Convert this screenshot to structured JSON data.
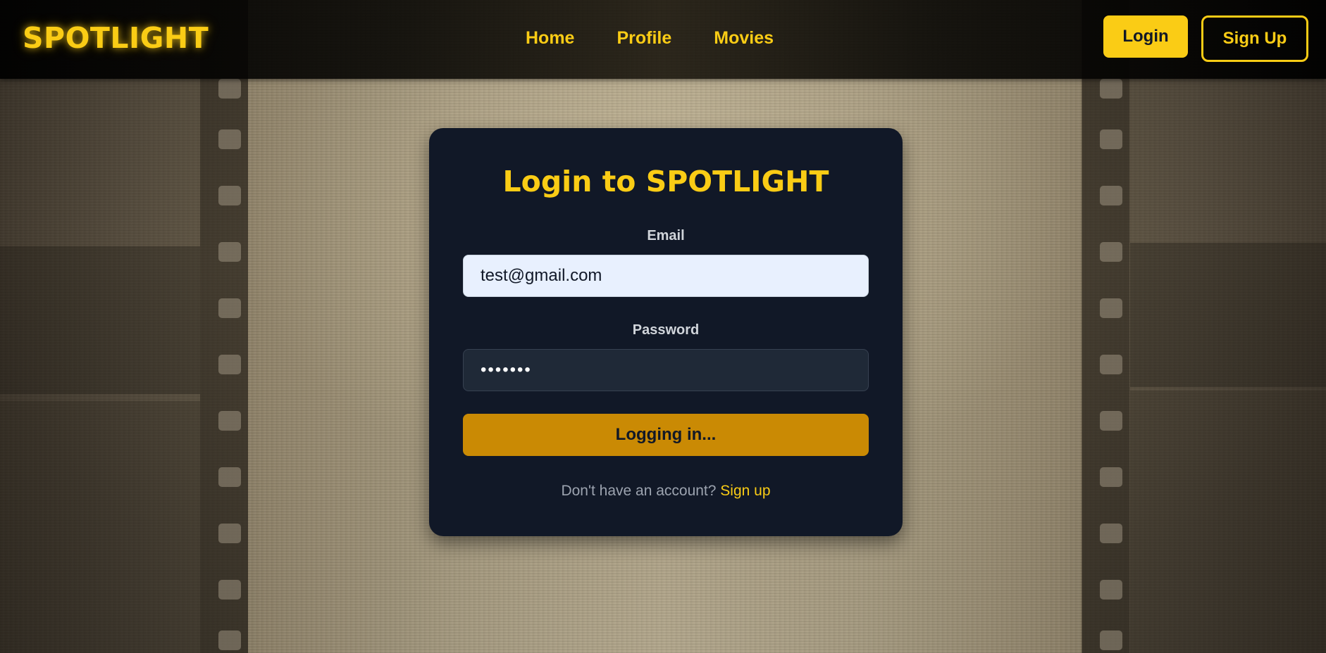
{
  "header": {
    "brand": "SPOTLIGHT",
    "nav": [
      {
        "label": "Home"
      },
      {
        "label": "Profile"
      },
      {
        "label": "Movies"
      }
    ],
    "login_label": "Login",
    "signup_label": "Sign Up"
  },
  "login_form": {
    "title": "Login to SPOTLIGHT",
    "email_label": "Email",
    "email_value": "test@gmail.com",
    "password_label": "Password",
    "password_value": "•••••••",
    "submit_label": "Logging in...",
    "footer_prompt": "Don't have an account?",
    "footer_link": "Sign up"
  },
  "colors": {
    "accent": "#facc15",
    "card_background": "#111827",
    "submit_button": "#ca8a04",
    "email_input_background": "#e8f0fe",
    "password_input_background": "#1f2937"
  }
}
